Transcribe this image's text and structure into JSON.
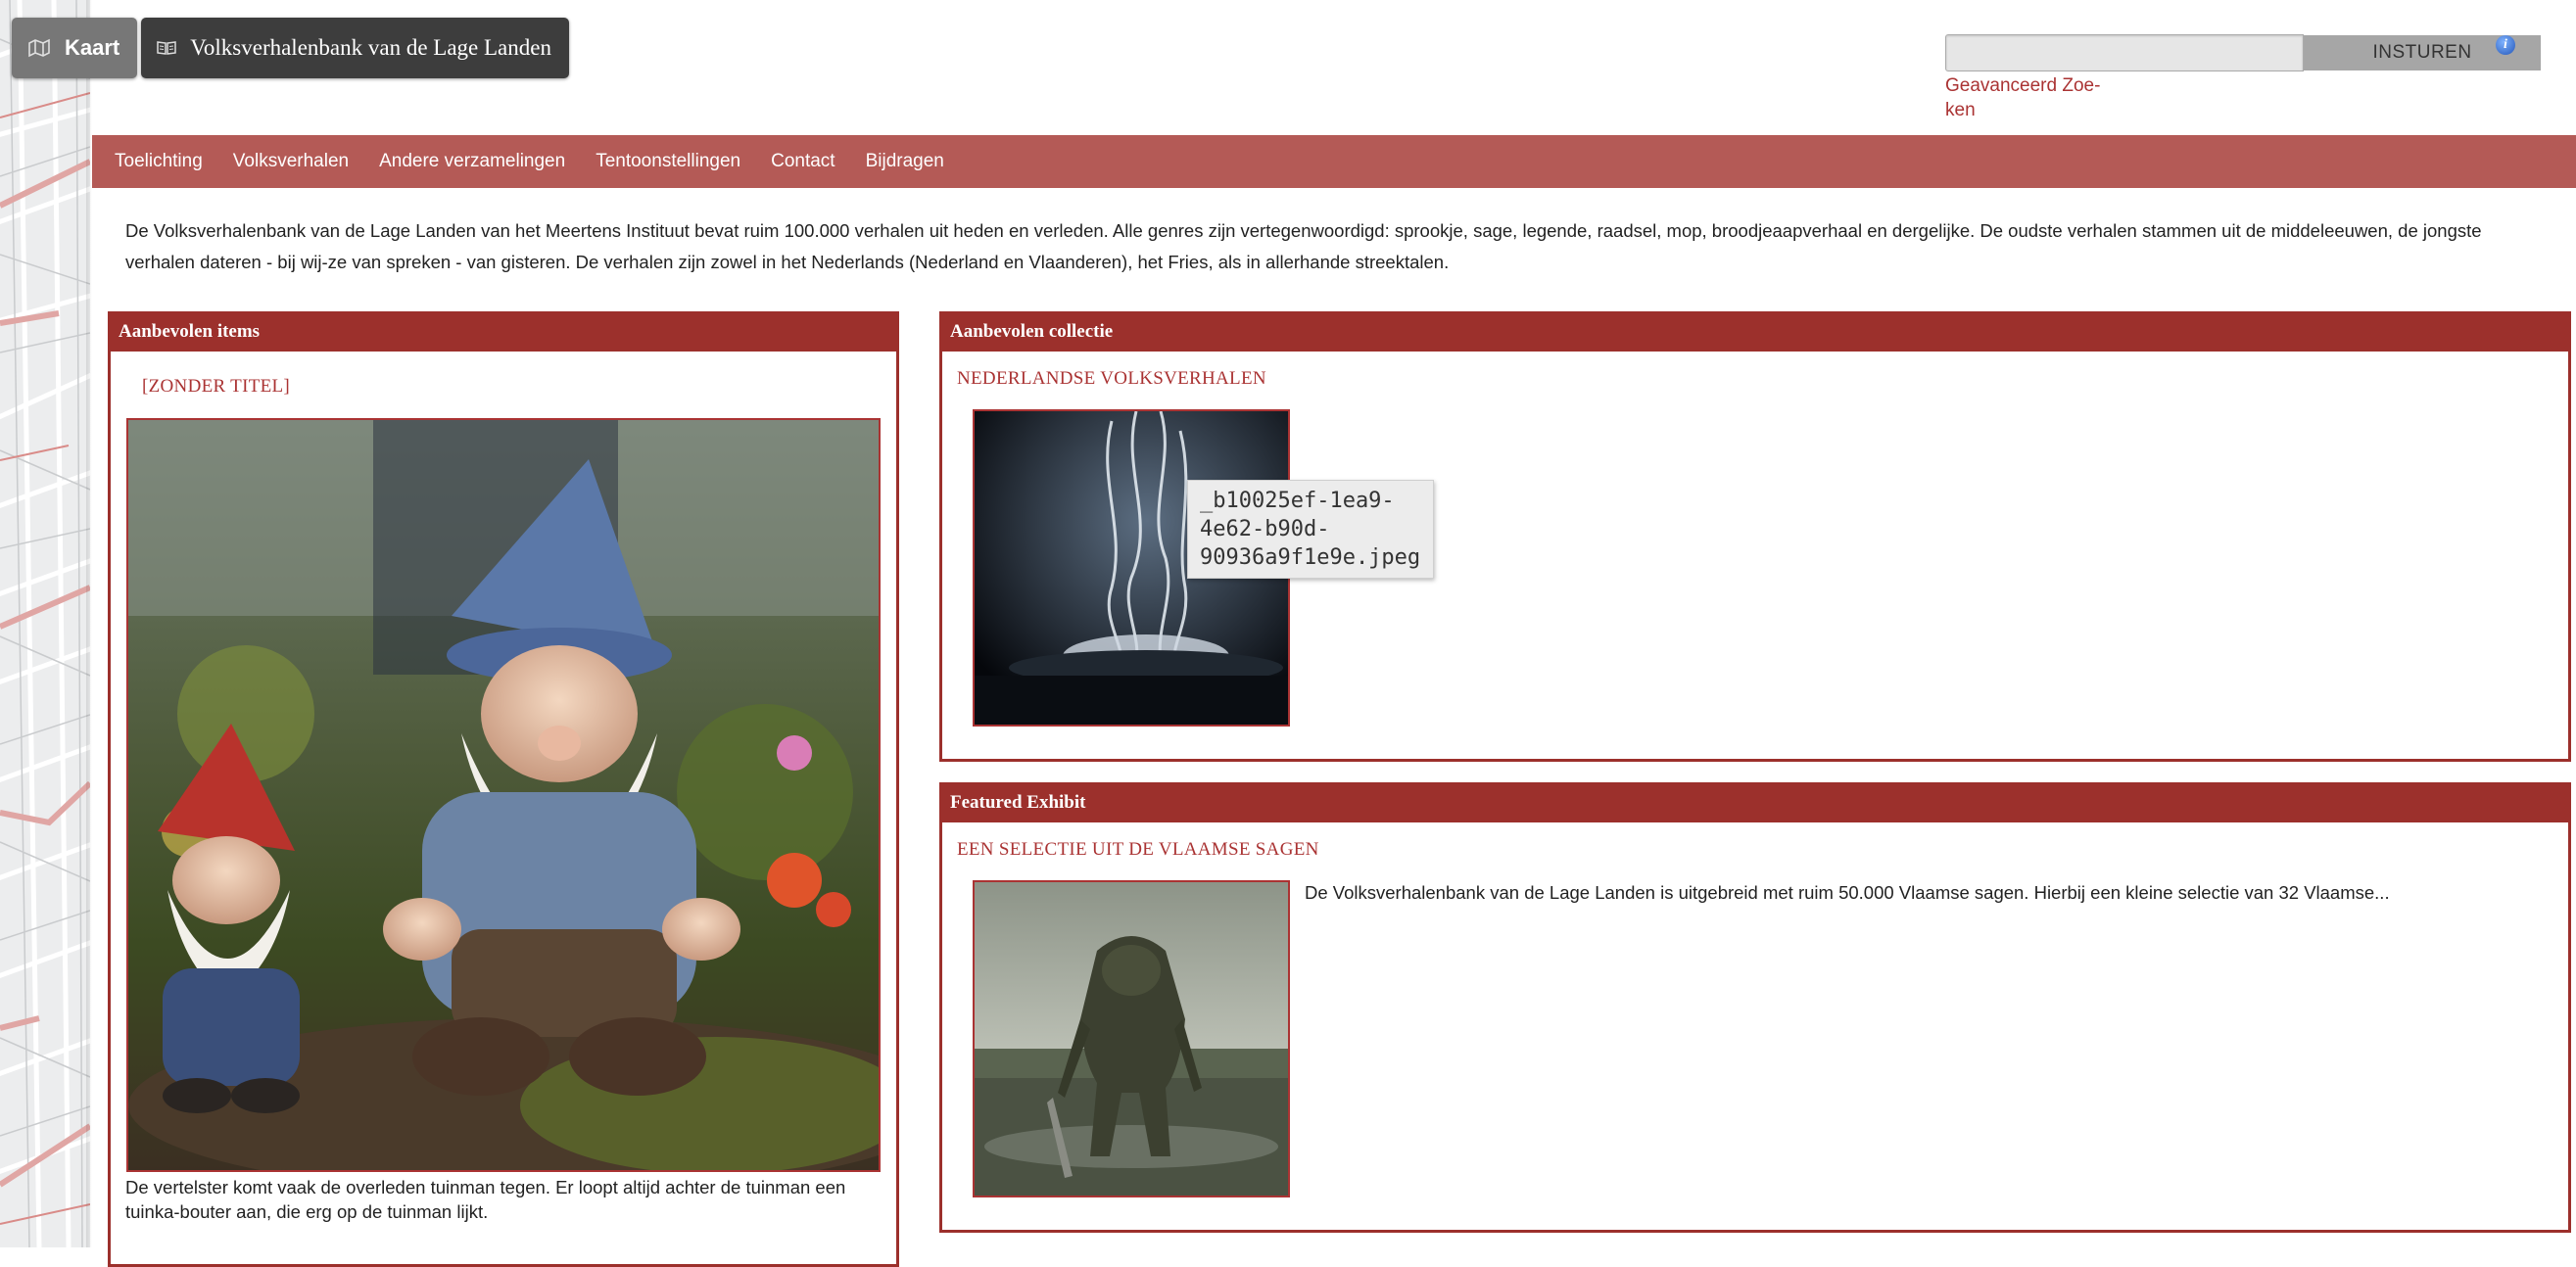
{
  "topbar": {
    "kaart_label": "Kaart",
    "site_title": "Volksverhalenbank van de Lage Landen"
  },
  "search": {
    "input_value": "",
    "submit_label": "INSTUREN",
    "advanced_label": "Geavanceerd Zoe-ken",
    "info_icon": "info-icon"
  },
  "nav": {
    "items": [
      "Toelichting",
      "Volksverhalen",
      "Andere verzamelingen",
      "Tentoonstellingen",
      "Contact",
      "Bijdragen"
    ]
  },
  "intro": {
    "text": "De Volksverhalenbank van de Lage Landen van het Meertens Instituut bevat ruim 100.000 verhalen uit heden en verleden. Alle genres zijn vertegenwoordigd: sprookje, sage, legende, raadsel, mop, broodjeaapverhaal en dergelijke. De oudste verhalen stammen uit de middeleeuwen, de jongste verhalen dateren - bij wij-ze van spreken - van gisteren. De verhalen zijn zowel in het Nederlands (Nederland en Vlaanderen), het Fries, als in allerhande streektalen."
  },
  "featured_items": {
    "header": "Aanbevolen items",
    "item_title": "[ZONDER TITEL]",
    "caption": "De vertelster komt vaak de overleden tuinman tegen. Er loopt altijd achter de tuinman een tuinka-bouter aan, die erg op de tuinman lijkt."
  },
  "featured_collection": {
    "header": "Aanbevolen collectie",
    "title": "NEDERLANDSE VOLKSVERHALEN",
    "tooltip": "_b10025ef-1ea9-4e62-b90d-90936a9f1e9e.jpeg"
  },
  "featured_exhibit": {
    "header": "Featured Exhibit",
    "title": "EEN SELECTIE UIT DE VLAAMSE SAGEN",
    "description": "De Volksverhalenbank van de Lage Landen is uitgebreid met ruim 50.000 Vlaamse sagen. Hierbij een kleine selectie van 32 Vlaamse..."
  },
  "colors": {
    "nav_bg": "#b45a56",
    "panel_accent": "#9c302c",
    "link": "#aa3333"
  }
}
